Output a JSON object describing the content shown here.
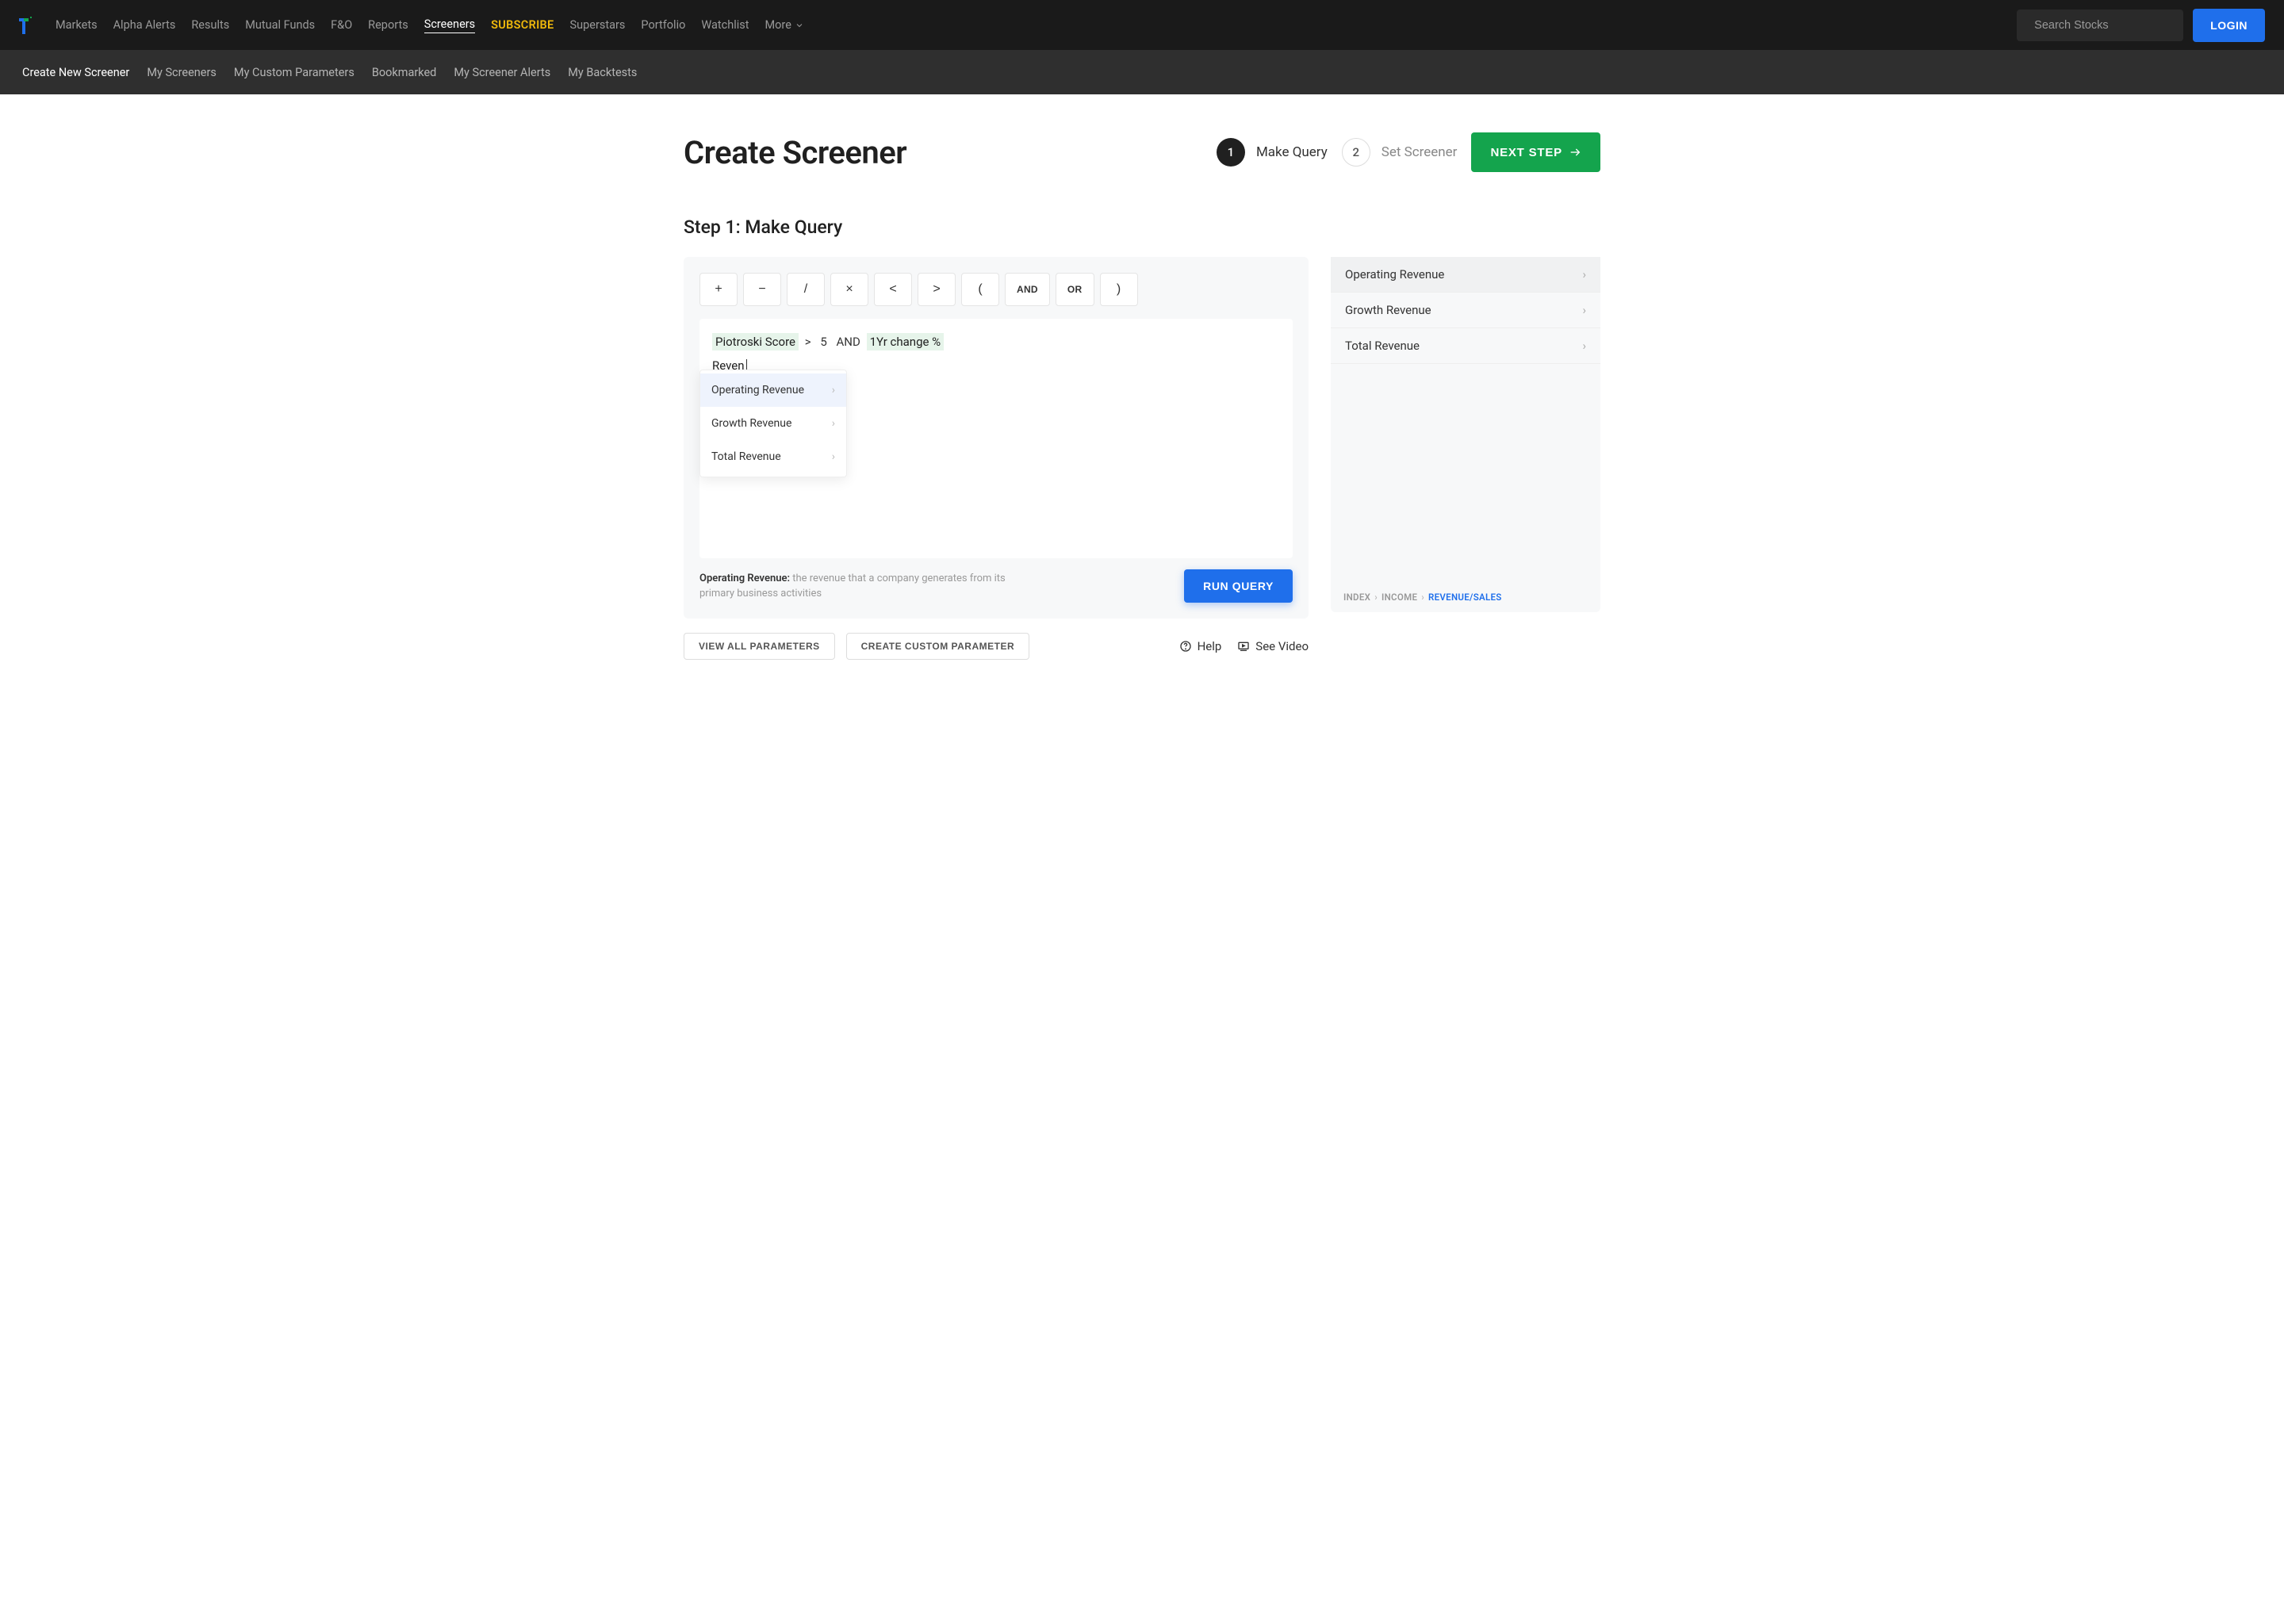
{
  "nav": {
    "items": [
      "Markets",
      "Alpha Alerts",
      "Results",
      "Mutual Funds",
      "F&O",
      "Reports",
      "Screeners",
      "SUBSCRIBE",
      "Superstars",
      "Portfolio",
      "Watchlist",
      "More"
    ],
    "active": "Screeners",
    "search_placeholder": "Search Stocks",
    "login": "LOGIN"
  },
  "subnav": {
    "items": [
      "Create New Screener",
      "My Screeners",
      "My Custom Parameters",
      "Bookmarked",
      "My Screener Alerts",
      "My Backtests"
    ],
    "active": "Create New Screener"
  },
  "page": {
    "title": "Create Screener",
    "step_heading": "Step 1: Make Query",
    "steps": [
      {
        "num": "1",
        "label": "Make Query",
        "active": true
      },
      {
        "num": "2",
        "label": "Set Screener",
        "active": false
      }
    ],
    "next": "NEXT STEP"
  },
  "operators": [
    "+",
    "−",
    "/",
    "×",
    "<",
    ">",
    "(",
    "AND",
    "OR",
    ")"
  ],
  "query": {
    "tokens": [
      {
        "text": "Piotroski Score",
        "cls": "param"
      },
      {
        "text": ">",
        "cls": "op"
      },
      {
        "text": "5",
        "cls": "op"
      },
      {
        "text": "AND",
        "cls": "op"
      },
      {
        "text": "1Yr change %",
        "cls": "param"
      }
    ],
    "typed": "Reven",
    "suggestions": [
      "Operating Revenue",
      "Growth Revenue",
      "Total Revenue"
    ],
    "suggest_selected": 0
  },
  "footer": {
    "help_label": "Operating Revenue:",
    "help_text": "the revenue that a company generates from its primary business activities",
    "run": "RUN QUERY"
  },
  "bottom": {
    "view_all": "VIEW ALL PARAMETERS",
    "create_custom": "CREATE CUSTOM PARAMETER",
    "help": "Help",
    "video": "See Video"
  },
  "right": {
    "items": [
      "Operating Revenue",
      "Growth Revenue",
      "Total Revenue"
    ],
    "selected": 0,
    "breadcrumb": [
      "INDEX",
      "INCOME",
      "REVENUE/SALES"
    ]
  }
}
